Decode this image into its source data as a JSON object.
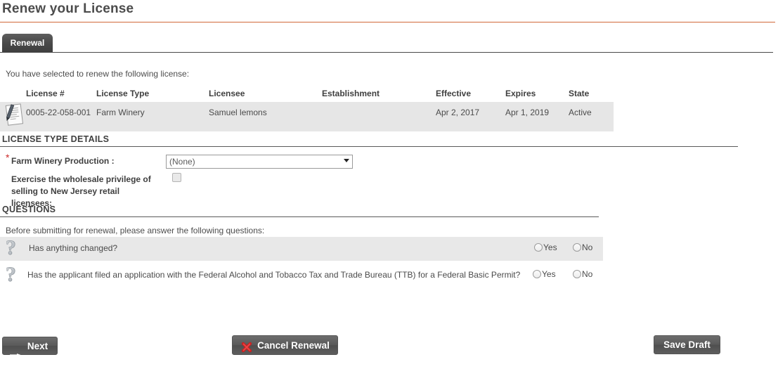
{
  "page": {
    "title": "Renew your License",
    "accent_rule_color": "#d2693a"
  },
  "tabs": [
    {
      "label": "Renewal",
      "active": true
    }
  ],
  "intro": {
    "text": "You have selected to renew the following license:"
  },
  "license_table": {
    "columns": [
      "License #",
      "License Type",
      "Licensee",
      "Establishment",
      "Effective",
      "Expires",
      "State"
    ],
    "row_icon": "document-pen-icon",
    "rows": [
      {
        "license_number": "0005-22-058-001",
        "license_type": "Farm Winery",
        "licensee": "Samuel lemons",
        "establishment": "",
        "effective": "Apr 2, 2017",
        "expires": "Apr 1, 2019",
        "state": "Active"
      }
    ]
  },
  "license_type_details": {
    "heading": "LICENSE TYPE DETAILS",
    "required_marker": "*",
    "production": {
      "label": "Farm Winery Production :",
      "selected": "(None)",
      "options": [
        "(None)"
      ]
    },
    "wholesale": {
      "label": "Exercise the wholesale privilege of selling to New Jersey retail licensees:",
      "checked": false
    }
  },
  "questions": {
    "heading": "QUESTIONS",
    "intro": "Before submitting for renewal, please answer the following questions:",
    "yes_label": "Yes",
    "no_label": "No",
    "items": [
      {
        "icon": "question-mark-icon",
        "text": "Has anything changed?",
        "answer": null
      },
      {
        "icon": "question-mark-icon",
        "text": "Has the applicant filed an application with the Federal Alcohol and Tobacco Tax and Trade Bureau (TTB) for a Federal Basic Permit?",
        "answer": null
      }
    ]
  },
  "footer": {
    "next_label": "Next",
    "cancel_label": "Cancel Renewal",
    "save_draft_label": "Save Draft"
  }
}
